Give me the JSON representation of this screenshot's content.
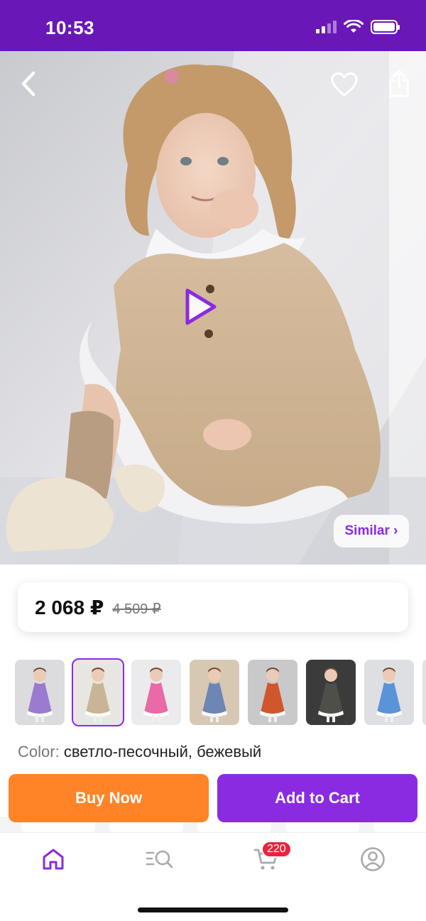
{
  "status_bar": {
    "time": "10:53"
  },
  "product": {
    "price_current": "2 068 ₽",
    "price_old": "4 509 ₽",
    "similar_label": "Similar ›",
    "color_label": "Color:",
    "color_value": "светло-песочный, бежевый",
    "thumbnails": [
      {
        "color": "#9b7bd0"
      },
      {
        "color": "#c9b497"
      },
      {
        "color": "#e86aa6"
      },
      {
        "color": "#6d86b4"
      },
      {
        "color": "#d0562d"
      },
      {
        "color": "#4f4f4a"
      },
      {
        "color": "#5b93d8"
      }
    ],
    "selected_thumbnail": 1
  },
  "actions": {
    "buy_now": "Buy Now",
    "add_to_cart": "Add to Cart"
  },
  "tab_bar": {
    "cart_badge": "220"
  },
  "colors": {
    "brand": "#6a17b8",
    "accent": "#8a2be2",
    "orange": "#ff8427",
    "badge": "#e8243c"
  },
  "icons": [
    "back-icon",
    "heart-icon",
    "share-icon",
    "play-icon",
    "home-icon",
    "catalog-search-icon",
    "cart-icon",
    "profile-icon"
  ]
}
